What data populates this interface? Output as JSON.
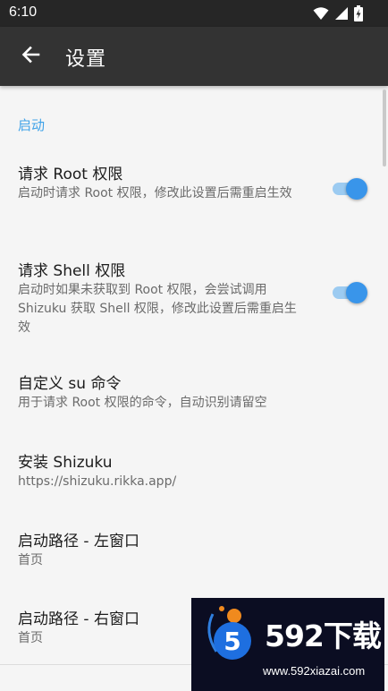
{
  "status_bar": {
    "time": "6:10",
    "icons": [
      "wifi-icon",
      "cell-signal-icon",
      "battery-charging-icon"
    ]
  },
  "app_bar": {
    "back_icon": "arrow-left-icon",
    "title": "设置"
  },
  "section": {
    "title": "启动"
  },
  "preferences": [
    {
      "title": "请求 Root 权限",
      "summary": "启动时请求 Root 权限，修改此设置后需重启生效",
      "switch_on": true
    },
    {
      "title": "请求 Shell 权限",
      "summary": "启动时如果未获取到 Root 权限，会尝试调用 Shizuku 获取 Shell 权限，修改此设置后需重启生效",
      "switch_on": true
    },
    {
      "title": "自定义 su 命令",
      "summary": "用于请求 Root 权限的命令，自动识别请留空"
    },
    {
      "title": "安装 Shizuku",
      "summary": "https://shizuku.rikka.app/"
    },
    {
      "title": "启动路径 - 左窗口",
      "summary": "首页"
    },
    {
      "title": "启动路径 - 右窗口",
      "summary": "首页"
    }
  ],
  "colors": {
    "accent": "#3fa2e8",
    "app_bar": "#333333",
    "status_bar": "#262626",
    "switch_thumb": "#3995ea",
    "switch_track": "#9ccbf1",
    "background": "#f5f5f5"
  },
  "watermark": {
    "logo_digit": "5",
    "brand": "592下载",
    "url": "www.592xiazai.com"
  }
}
